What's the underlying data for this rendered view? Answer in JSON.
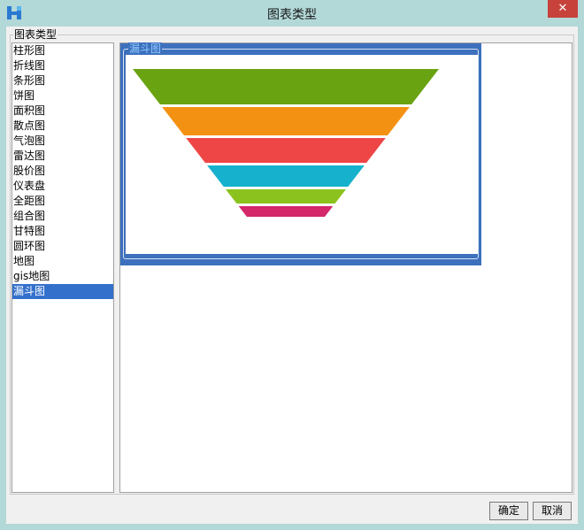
{
  "window": {
    "title": "图表类型",
    "close_glyph": "✕",
    "app_icon": "app-logo-icon"
  },
  "group": {
    "label": "图表类型"
  },
  "chart_types": [
    {
      "label": "柱形图"
    },
    {
      "label": "折线图"
    },
    {
      "label": "条形图"
    },
    {
      "label": "饼图"
    },
    {
      "label": "面积图"
    },
    {
      "label": "散点图"
    },
    {
      "label": "气泡图"
    },
    {
      "label": "雷达图"
    },
    {
      "label": "股价图"
    },
    {
      "label": "仪表盘"
    },
    {
      "label": "全距图"
    },
    {
      "label": "组合图"
    },
    {
      "label": "甘特图"
    },
    {
      "label": "圆环图"
    },
    {
      "label": "地图"
    },
    {
      "label": "gis地图"
    },
    {
      "label": "漏斗图",
      "selected": true
    }
  ],
  "preview": {
    "label": "漏斗图",
    "accent_color": "#3d70bd",
    "label_color": "#8fc8ff"
  },
  "buttons": {
    "ok": "确定",
    "cancel": "取消"
  },
  "chart_data": {
    "type": "funnel",
    "stages": [
      {
        "value": 100,
        "color": "#6aa312"
      },
      {
        "value": 80,
        "color": "#f39212"
      },
      {
        "value": 70,
        "color": "#ee4646"
      },
      {
        "value": 60,
        "color": "#16b1cc"
      },
      {
        "value": 40,
        "color": "#8bc21d"
      },
      {
        "value": 30,
        "color": "#d4286b"
      }
    ]
  }
}
